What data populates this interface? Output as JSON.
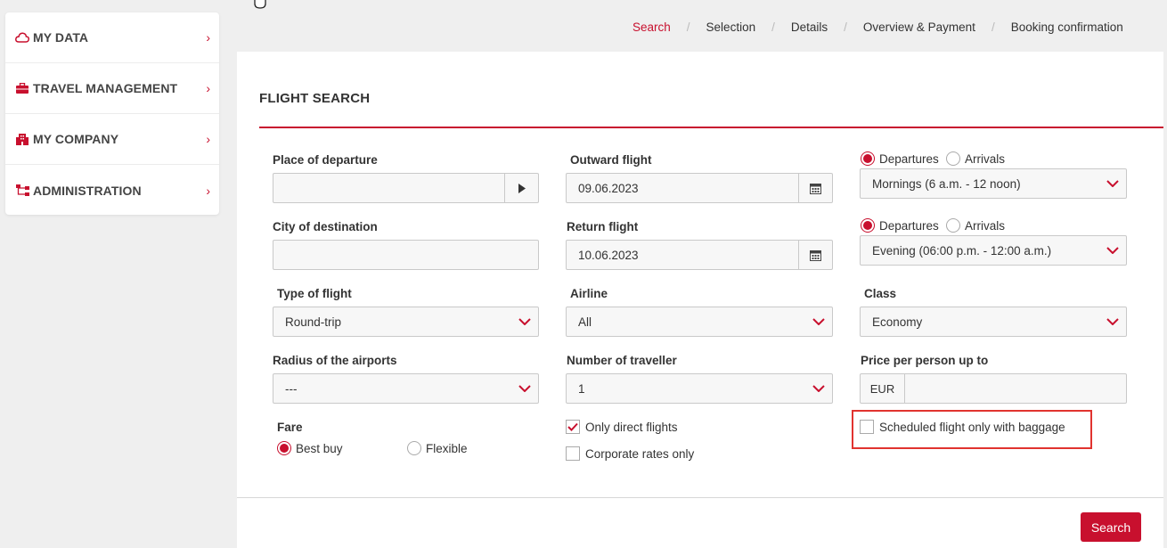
{
  "sidebar": {
    "items": [
      {
        "label": "MY DATA",
        "icon": "cloud-icon"
      },
      {
        "label": "TRAVEL MANAGEMENT",
        "icon": "briefcase-icon"
      },
      {
        "label": "MY COMPANY",
        "icon": "building-icon"
      },
      {
        "label": "ADMINISTRATION",
        "icon": "sitemap-icon"
      }
    ]
  },
  "breadcrumb": [
    "Search",
    "Selection",
    "Details",
    "Overview & Payment",
    "Booking confirmation"
  ],
  "form": {
    "title": "FLIGHT SEARCH",
    "departure": {
      "label": "Place of departure",
      "value": ""
    },
    "destination": {
      "label": "City of destination",
      "value": ""
    },
    "outward": {
      "label": "Outward flight",
      "value": "09.06.2023"
    },
    "return": {
      "label": "Return flight",
      "value": "10.06.2023"
    },
    "outward_time": {
      "opt1": "Departures",
      "opt2": "Arrivals",
      "selected": "Departures",
      "value": "Mornings (6 a.m. - 12 noon)"
    },
    "return_time": {
      "opt1": "Departures",
      "opt2": "Arrivals",
      "selected": "Departures",
      "value": "Evening (06:00 p.m. - 12:00 a.m.)"
    },
    "flight_type": {
      "label": "Type of flight",
      "value": "Round-trip"
    },
    "airline": {
      "label": "Airline",
      "value": "All"
    },
    "class": {
      "label": "Class",
      "value": "Economy"
    },
    "radius": {
      "label": "Radius of the airports",
      "value": "---"
    },
    "travellers": {
      "label": "Number of traveller",
      "value": "1"
    },
    "price": {
      "label": "Price per person up to",
      "currency": "EUR",
      "value": ""
    },
    "fare": {
      "label": "Fare",
      "opt1": "Best buy",
      "opt2": "Flexible",
      "selected": "Best buy"
    },
    "direct": {
      "label": "Only direct flights",
      "checked": true
    },
    "corporate": {
      "label": "Corporate rates only",
      "checked": false
    },
    "baggage": {
      "label": "Scheduled flight only with baggage",
      "checked": false
    },
    "search_label": "Search"
  },
  "colors": {
    "accent": "#c8102e",
    "highlight": "#e1332f"
  }
}
